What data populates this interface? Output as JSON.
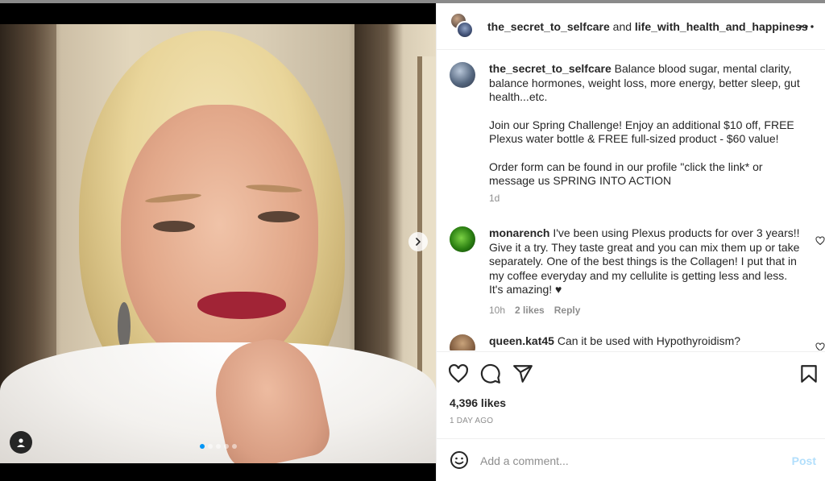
{
  "post": {
    "header": {
      "author": "the_secret_to_selfcare",
      "joiner": "and",
      "collaborator": "life_with_health_and_happiness"
    },
    "caption": {
      "username": "the_secret_to_selfcare",
      "text_line1": "Balance blood sugar, mental clarity, balance hormones, weight loss, more energy, better sleep, gut health...etc.",
      "paragraph2": "Join our Spring Challenge! Enjoy an additional $10 off, FREE Plexus water bottle & FREE full-sized product - $60 value!",
      "paragraph3": "Order form can be found in our profile \"click the link* or message us SPRING INTO ACTION",
      "time": "1d"
    },
    "comments": [
      {
        "username": "monarench",
        "text": "I've been using Plexus products for over 3 years!! Give it a try. They taste great and you can mix them up or take separately. One of the best things is the Collagen! I put that in my coffee everyday and my cellulite is getting less and less. It's amazing! ♥",
        "time": "10h",
        "likes": "2 likes",
        "reply": "Reply"
      },
      {
        "username": "queen.kat45",
        "text": "Can it be used with Hypothyroidism?"
      }
    ],
    "likes_count": "4,396 likes",
    "posted_ago": "1 DAY AGO",
    "add_comment_placeholder": "Add a comment...",
    "post_label": "Post",
    "carousel": {
      "total": 5,
      "active": 0
    }
  },
  "colors": {
    "accent": "#0095f6",
    "post_disabled": "#b2dffc",
    "muted": "#8e8e8e",
    "text": "#262626"
  },
  "icons": [
    "more-icon",
    "heart-icon",
    "comment-icon",
    "share-icon",
    "save-icon",
    "emoji-icon",
    "chevron-right-icon",
    "user-tag-icon"
  ]
}
